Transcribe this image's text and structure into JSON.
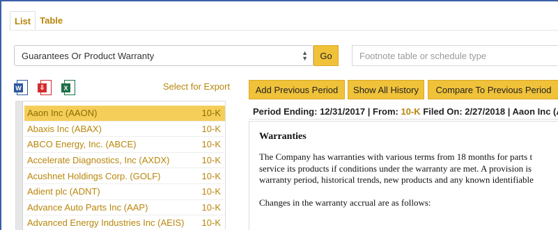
{
  "tabs": [
    {
      "label": "List",
      "active": true
    },
    {
      "label": "Table",
      "active": false
    }
  ],
  "search": {
    "selected_value": "Guarantees Or Product Warranty",
    "go_label": "Go",
    "footnote_placeholder": "Footnote table or schedule type"
  },
  "export": {
    "label": "Select for Export",
    "icons": [
      "word-icon",
      "pdf-icon",
      "excel-icon"
    ]
  },
  "companies": [
    {
      "name": "Aaon Inc (AAON)",
      "form": "10-K",
      "selected": true
    },
    {
      "name": "Abaxis Inc (ABAX)",
      "form": "10-K"
    },
    {
      "name": "ABCO Energy, Inc. (ABCE)",
      "form": "10-K"
    },
    {
      "name": "Accelerate Diagnostics, Inc (AXDX)",
      "form": "10-K"
    },
    {
      "name": "Acushnet Holdings Corp. (GOLF)",
      "form": "10-K"
    },
    {
      "name": "Adient plc (ADNT)",
      "form": "10-K"
    },
    {
      "name": "Advance Auto Parts Inc (AAP)",
      "form": "10-K"
    },
    {
      "name": "Advanced Energy Industries Inc (AEIS)",
      "form": "10-K"
    }
  ],
  "actions": {
    "add_previous": "Add Previous Period",
    "show_history": "Show All History",
    "compare": "Compare To Previous Period"
  },
  "period": {
    "ending_label": "Period Ending:",
    "ending_date": "12/31/2017",
    "from_label": "From:",
    "form": "10-K",
    "filed_label": "Filed On:",
    "filed_date": "2/27/2018",
    "company": "Aaon Inc (A"
  },
  "document": {
    "heading": "Warranties",
    "lines": [
      "The Company has warranties with various terms from 18 months for parts t",
      "service its products if conditions under the warranty are met. A provision is",
      "warranty period, historical trends, new products and any known identifiable"
    ],
    "para2": "Changes in the warranty accrual are as follows:"
  },
  "colors": {
    "accent": "#f0c23a",
    "link": "#b8860b",
    "selected_row": "#f5ce5a"
  }
}
